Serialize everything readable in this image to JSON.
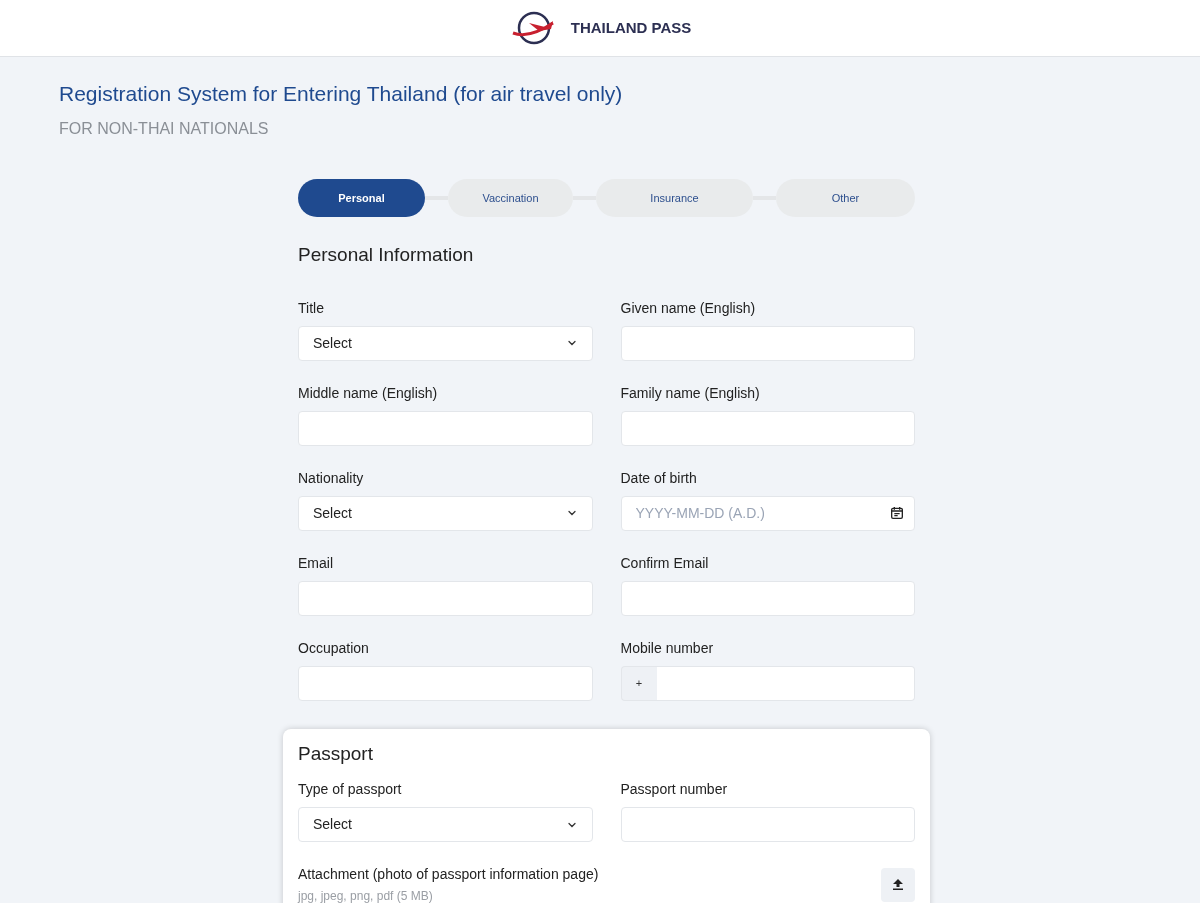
{
  "header": {
    "brand": "THAILAND PASS"
  },
  "page": {
    "title": "Registration System for Entering Thailand (for air travel only)",
    "subtitle": "FOR NON-THAI NATIONALS"
  },
  "steps": [
    {
      "label": "Personal",
      "selected": true
    },
    {
      "label": "Vaccination",
      "selected": false
    },
    {
      "label": "Insurance",
      "selected": false
    },
    {
      "label": "Other",
      "selected": false
    }
  ],
  "personal": {
    "heading": "Personal Information",
    "fields": [
      {
        "label": "Title",
        "kind": "select",
        "value": "Select"
      },
      {
        "label": "Given name (English)",
        "kind": "text"
      },
      {
        "label": "Middle name (English)",
        "kind": "text"
      },
      {
        "label": "Family name (English)",
        "kind": "text"
      },
      {
        "label": "Nationality",
        "kind": "select",
        "value": "Select"
      },
      {
        "label": "Date of birth",
        "kind": "date",
        "placeholder": "YYYY-MM-DD (A.D.)"
      },
      {
        "label": "Email",
        "kind": "text"
      },
      {
        "label": "Confirm Email",
        "kind": "text"
      },
      {
        "label": "Occupation",
        "kind": "text"
      },
      {
        "label": "Mobile number",
        "kind": "phone",
        "prefix": "+"
      }
    ]
  },
  "passport": {
    "heading": "Passport",
    "fields": [
      {
        "label": "Type of passport",
        "kind": "select",
        "value": "Select"
      },
      {
        "label": "Passport number",
        "kind": "text"
      }
    ],
    "attachment": {
      "label": "Attachment (photo of passport information page)",
      "hint": "jpg, jpeg, png, pdf (5 MB)"
    }
  }
}
